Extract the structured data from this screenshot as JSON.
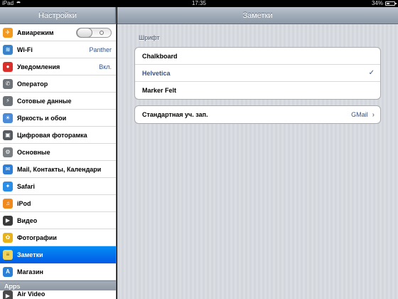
{
  "statusbar": {
    "device": "iPad",
    "time": "17:35",
    "battery": "34%",
    "battery_level": 0.34
  },
  "sidebar": {
    "title": "Настройки",
    "items": [
      {
        "label": "Авиарежим",
        "icon": "airplane-icon",
        "color": "#f39a1e",
        "glyph": "✈",
        "toggle": true
      },
      {
        "label": "Wi-Fi",
        "icon": "wifi-icon",
        "color": "#3b82c9",
        "glyph": "≋",
        "value": "Panther"
      },
      {
        "label": "Уведомления",
        "icon": "notifications-icon",
        "color": "#d9302b",
        "glyph": "●",
        "value": "Вкл."
      },
      {
        "label": "Оператор",
        "icon": "phone-icon",
        "color": "#6d7378",
        "glyph": "✆"
      },
      {
        "label": "Сотовые данные",
        "icon": "cellular-icon",
        "color": "#6d7378",
        "glyph": "⚡"
      },
      {
        "label": "Яркость и обои",
        "icon": "brightness-icon",
        "color": "#4b8ad6",
        "glyph": "☀"
      },
      {
        "label": "Цифровая фоторамка",
        "icon": "photo-frame-icon",
        "color": "#555b60",
        "glyph": "▣"
      },
      {
        "label": "Основные",
        "icon": "gear-icon",
        "color": "#7a7f84",
        "glyph": "⚙"
      },
      {
        "label": "Mail, Контакты, Календари",
        "icon": "mail-icon",
        "color": "#2f7fd6",
        "glyph": "✉"
      },
      {
        "label": "Safari",
        "icon": "safari-icon",
        "color": "#2a8ee8",
        "glyph": "✦"
      },
      {
        "label": "iPod",
        "icon": "ipod-icon",
        "color": "#f08a1c",
        "glyph": "♫"
      },
      {
        "label": "Видео",
        "icon": "video-icon",
        "color": "#3a3a3a",
        "glyph": "▶"
      },
      {
        "label": "Фотографии",
        "icon": "sunflower-icon",
        "color": "#e8b21b",
        "glyph": "✿"
      },
      {
        "label": "Заметки",
        "icon": "notes-icon",
        "color": "#f0d35a",
        "glyph": "≡",
        "selected": true
      },
      {
        "label": "Магазин",
        "icon": "store-icon",
        "color": "#2a7fd6",
        "glyph": "A"
      }
    ],
    "apps_header": "Apps",
    "partial_item": {
      "label": "Air Video",
      "icon": "air-video-icon",
      "color": "#4a4a4a",
      "glyph": "▶"
    }
  },
  "main": {
    "title": "Заметки",
    "font_group_label": "Шрифт",
    "fonts": [
      {
        "label": "Chalkboard",
        "checked": false
      },
      {
        "label": "Helvetica",
        "checked": true
      },
      {
        "label": "Marker Felt",
        "checked": false
      }
    ],
    "account": {
      "label": "Стандартная уч. зап.",
      "value": "GMail"
    }
  }
}
